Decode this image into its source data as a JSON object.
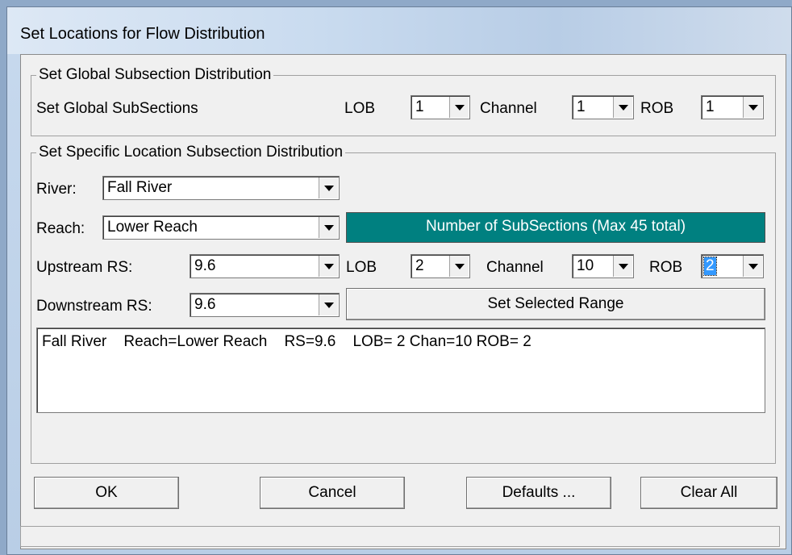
{
  "window": {
    "title": "Set Locations for Flow Distribution"
  },
  "global": {
    "group_label": "Set Global Subsection Distribution",
    "row_label": "Set Global SubSections",
    "lob_label": "LOB",
    "lob_value": "1",
    "channel_label": "Channel",
    "channel_value": "1",
    "rob_label": "ROB",
    "rob_value": "1"
  },
  "specific": {
    "group_label": "Set Specific Location Subsection Distribution",
    "river_label": "River:",
    "river_value": "Fall River",
    "reach_label": "Reach:",
    "reach_value": "Lower Reach",
    "banner": "Number of SubSections (Max 45 total)",
    "upstream_label": "Upstream RS:",
    "upstream_value": "9.6",
    "downstream_label": "Downstream RS:",
    "downstream_value": "9.6",
    "lob_label": "LOB",
    "lob_value": "2",
    "channel_label": "Channel",
    "channel_value": "10",
    "rob_label": "ROB",
    "rob_value": "2",
    "set_range_button": "Set Selected Range",
    "list": [
      {
        "river": "Fall River",
        "reach": "Reach=Lower Reach",
        "rs": "RS=9.6",
        "dist": "LOB= 2 Chan=10 ROB= 2"
      }
    ]
  },
  "buttons": {
    "ok": "OK",
    "cancel": "Cancel",
    "defaults": "Defaults ...",
    "clear_all": "Clear All"
  }
}
